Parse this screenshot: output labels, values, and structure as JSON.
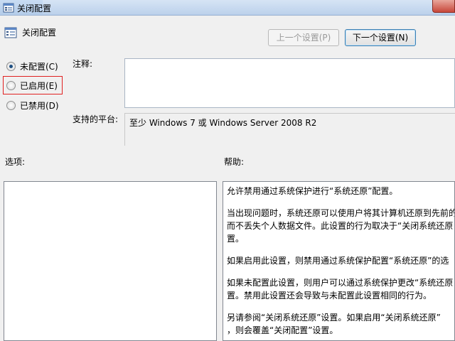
{
  "window": {
    "title": "关闭配置"
  },
  "header": {
    "title": "关闭配置"
  },
  "buttons": {
    "prev": "上一个设置(P)",
    "next": "下一个设置(N)"
  },
  "radios": [
    {
      "label": "未配置(C)",
      "checked": true
    },
    {
      "label": "已启用(E)",
      "checked": false
    },
    {
      "label": "已禁用(D)",
      "checked": false
    }
  ],
  "labels": {
    "comment": "注释:",
    "platform": "支持的平台:",
    "options": "选项:",
    "help": "帮助:"
  },
  "platform_value": "至少 Windows 7 或 Windows Server 2008 R2",
  "help_text": [
    [
      "允许禁用通过系统保护进行“系统还原”配置。"
    ],
    [
      "当出现问题时，系统还原可以使用户将其计算机还原到先前的",
      "而不丢失个人数据文件。此设置的行为取决于“关闭系统还原",
      "置。"
    ],
    [
      "如果启用此设置，则禁用通过系统保护配置“系统还原”的选"
    ],
    [
      "如果未配置此设置，则用户可以通过系统保护更改“系统还原",
      "置。禁用此设置还会导致与未配置此设置相同的行为。"
    ],
    [
      "另请参阅“关闭系统还原”设置。如果启用“关闭系统还原”",
      "，则会覆盖“关闭配置”设置。"
    ]
  ],
  "colors": {
    "highlight": "#e02020",
    "background": "#f0f0f0"
  }
}
